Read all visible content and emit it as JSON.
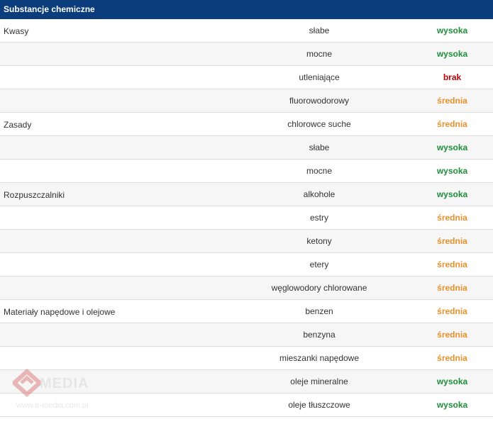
{
  "header": {
    "title": "Substancje chemiczne"
  },
  "rows": [
    {
      "category": "Kwasy",
      "substance": "słabe",
      "level": "wysoka",
      "tone": "green"
    },
    {
      "category": "",
      "substance": "mocne",
      "level": "wysoka",
      "tone": "green"
    },
    {
      "category": "",
      "substance": "utleniające",
      "level": "brak",
      "tone": "red"
    },
    {
      "category": "",
      "substance": "fluorowodorowy",
      "level": "średnia",
      "tone": "orange"
    },
    {
      "category": "Zasady",
      "substance": "chlorowce suche",
      "level": "średnia",
      "tone": "orange"
    },
    {
      "category": "",
      "substance": "słabe",
      "level": "wysoka",
      "tone": "green"
    },
    {
      "category": "",
      "substance": "mocne",
      "level": "wysoka",
      "tone": "green"
    },
    {
      "category": "Rozpuszczalniki",
      "substance": "alkohole",
      "level": "wysoka",
      "tone": "green"
    },
    {
      "category": "",
      "substance": "estry",
      "level": "średnia",
      "tone": "orange"
    },
    {
      "category": "",
      "substance": "ketony",
      "level": "średnia",
      "tone": "orange"
    },
    {
      "category": "",
      "substance": "etery",
      "level": "średnia",
      "tone": "orange"
    },
    {
      "category": "",
      "substance": "węglowodory chlorowane",
      "level": "średnia",
      "tone": "orange"
    },
    {
      "category": "Materiały napędowe i olejowe",
      "substance": "benzen",
      "level": "średnia",
      "tone": "orange"
    },
    {
      "category": "",
      "substance": "benzyna",
      "level": "średnia",
      "tone": "orange"
    },
    {
      "category": "",
      "substance": "mieszanki napędowe",
      "level": "średnia",
      "tone": "orange"
    },
    {
      "category": "",
      "substance": "oleje mineralne",
      "level": "wysoka",
      "tone": "green"
    },
    {
      "category": "",
      "substance": "oleje tłuszczowe",
      "level": "wysoka",
      "tone": "green"
    }
  ],
  "watermark": {
    "brand": "MEDIA",
    "url": "www.e-media.com.pl"
  },
  "colors": {
    "header": "#0b3d7c",
    "green": "#1f8f3a",
    "orange": "#e8902b",
    "red": "#c00000"
  }
}
